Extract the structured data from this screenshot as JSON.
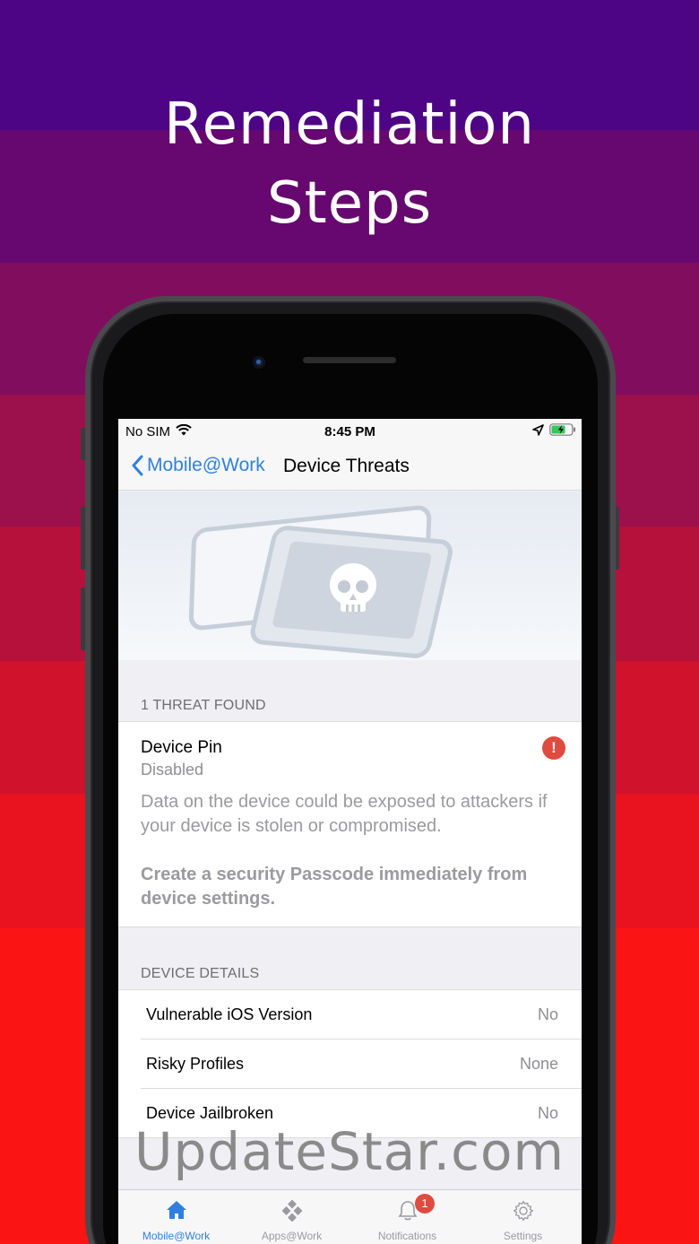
{
  "headline": {
    "line1": "Remediation",
    "line2": "Steps"
  },
  "colors": {
    "bands": [
      "#4d0485",
      "#66086f",
      "#810d5f",
      "#9c104c",
      "#b5113b",
      "#d0122c",
      "#e8131f",
      "#fb1414"
    ],
    "accent": "#2f7fe0",
    "alert": "#e04b3f"
  },
  "status_bar": {
    "carrier": "No SIM",
    "time": "8:45 PM"
  },
  "nav": {
    "back_label": "Mobile@Work",
    "title": "Device Threats"
  },
  "threats": {
    "header": "1 THREAT FOUND",
    "item": {
      "title": "Device Pin",
      "status": "Disabled",
      "alert_icon": "!",
      "description": "Data on the device could be exposed to attackers if your device is stolen or compromised.",
      "action": "Create a security Passcode immediately from device settings."
    }
  },
  "device_details": {
    "header": "DEVICE DETAILS",
    "rows": [
      {
        "label": "Vulnerable iOS Version",
        "value": "No"
      },
      {
        "label": "Risky Profiles",
        "value": "None"
      },
      {
        "label": "Device Jailbroken",
        "value": "No"
      }
    ]
  },
  "tabbar": {
    "tabs": [
      {
        "label": "Mobile@Work",
        "icon": "home-icon",
        "active": true
      },
      {
        "label": "Apps@Work",
        "icon": "apps-icon"
      },
      {
        "label": "Notifications",
        "icon": "bell-icon",
        "badge": "1"
      },
      {
        "label": "Settings",
        "icon": "gear-icon"
      }
    ]
  },
  "watermark": "UpdateStar.com"
}
